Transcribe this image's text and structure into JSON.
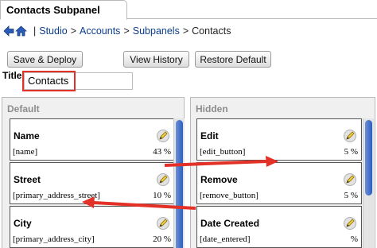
{
  "tab": {
    "label": "Contacts Subpanel"
  },
  "breadcrumb": {
    "separator": "|",
    "items": [
      "Studio",
      "Accounts",
      "Subpanels"
    ],
    "divider": ">",
    "current": "Contacts"
  },
  "buttons": {
    "save_deploy": "Save & Deploy",
    "view_history": "View History",
    "restore_default": "Restore Default"
  },
  "title_field": {
    "label": "Title",
    "value": "Contacts"
  },
  "default_panel": {
    "title": "Default",
    "fields": [
      {
        "name": "Name",
        "key": "[name]",
        "width": "43 %"
      },
      {
        "name": "Street",
        "key": "[primary_address_street]",
        "width": "10 %"
      },
      {
        "name": "City",
        "key": "[primary_address_city]",
        "width": "20 %"
      }
    ]
  },
  "hidden_panel": {
    "title": "Hidden",
    "fields": [
      {
        "name": "Edit",
        "key": "[edit_button]",
        "width": "5 %"
      },
      {
        "name": "Remove",
        "key": "[remove_button]",
        "width": "5 %"
      },
      {
        "name": "Date Created",
        "key": "[date_entered]",
        "width": "%"
      }
    ]
  },
  "colors": {
    "link": "#0b3c8c",
    "annotation_red": "#e33127",
    "scroll_thumb": "#2d5fc0"
  },
  "icons": [
    "back-arrow-icon",
    "home-icon",
    "pencil-edit-icon"
  ]
}
